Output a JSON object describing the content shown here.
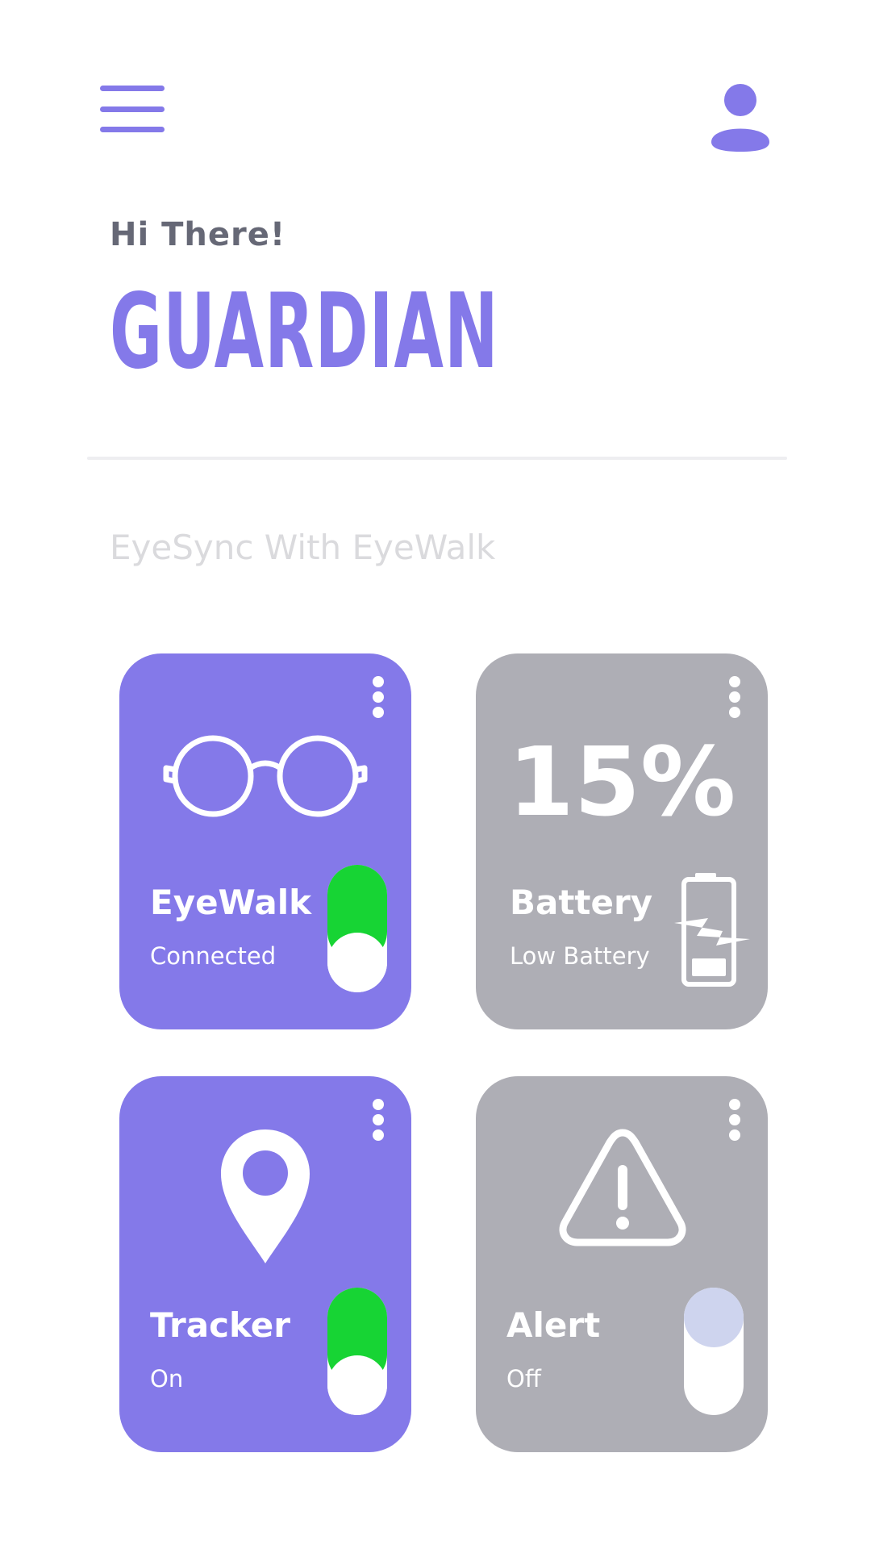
{
  "header": {
    "menu_icon": "hamburger-menu-icon",
    "profile_icon": "user-icon",
    "greeting": "Hi There!",
    "title": "GUARDIAN"
  },
  "section": {
    "subtitle": "EyeSync With EyeWalk"
  },
  "cards": [
    {
      "id": "eyewalk",
      "icon": "glasses-icon",
      "title": "EyeWalk",
      "status": "Connected",
      "toggle_on": true,
      "background": "#8479E9"
    },
    {
      "id": "battery",
      "icon": "low-battery-icon",
      "value": "15%",
      "title": "Battery",
      "status": "Low Battery",
      "background": "#AEAEB5"
    },
    {
      "id": "tracker",
      "icon": "location-pin-icon",
      "title": "Tracker",
      "status": "On",
      "toggle_on": true,
      "background": "#8479E9"
    },
    {
      "id": "alert",
      "icon": "warning-triangle-icon",
      "title": "Alert",
      "status": "Off",
      "toggle_on": false,
      "background": "#AEAEB5"
    }
  ],
  "colors": {
    "accent": "#8479E9",
    "inactive": "#AEAEB5",
    "toggle_on": "#17D434",
    "toggle_off_knob": "#CED4EE",
    "greeting_text": "#666876",
    "subtitle_text": "#DADADD"
  }
}
